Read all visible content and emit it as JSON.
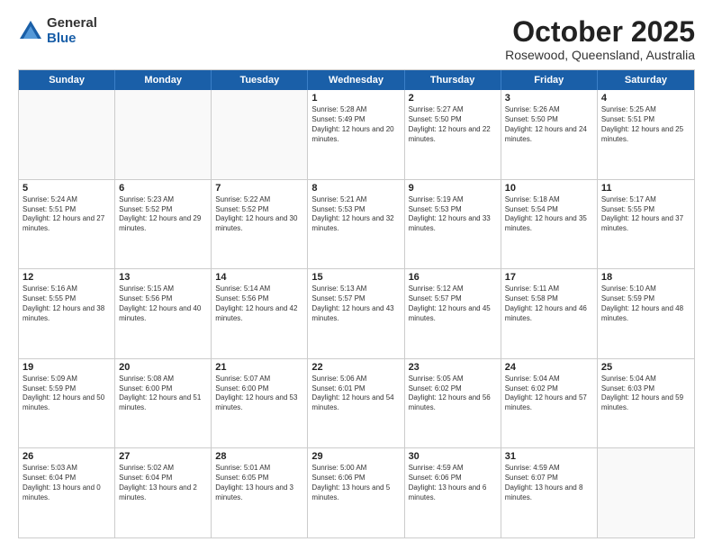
{
  "logo": {
    "general": "General",
    "blue": "Blue"
  },
  "header": {
    "month": "October 2025",
    "location": "Rosewood, Queensland, Australia"
  },
  "weekdays": [
    "Sunday",
    "Monday",
    "Tuesday",
    "Wednesday",
    "Thursday",
    "Friday",
    "Saturday"
  ],
  "rows": [
    [
      {
        "day": "",
        "sunrise": "",
        "sunset": "",
        "daylight": ""
      },
      {
        "day": "",
        "sunrise": "",
        "sunset": "",
        "daylight": ""
      },
      {
        "day": "",
        "sunrise": "",
        "sunset": "",
        "daylight": ""
      },
      {
        "day": "1",
        "sunrise": "Sunrise: 5:28 AM",
        "sunset": "Sunset: 5:49 PM",
        "daylight": "Daylight: 12 hours and 20 minutes."
      },
      {
        "day": "2",
        "sunrise": "Sunrise: 5:27 AM",
        "sunset": "Sunset: 5:50 PM",
        "daylight": "Daylight: 12 hours and 22 minutes."
      },
      {
        "day": "3",
        "sunrise": "Sunrise: 5:26 AM",
        "sunset": "Sunset: 5:50 PM",
        "daylight": "Daylight: 12 hours and 24 minutes."
      },
      {
        "day": "4",
        "sunrise": "Sunrise: 5:25 AM",
        "sunset": "Sunset: 5:51 PM",
        "daylight": "Daylight: 12 hours and 25 minutes."
      }
    ],
    [
      {
        "day": "5",
        "sunrise": "Sunrise: 5:24 AM",
        "sunset": "Sunset: 5:51 PM",
        "daylight": "Daylight: 12 hours and 27 minutes."
      },
      {
        "day": "6",
        "sunrise": "Sunrise: 5:23 AM",
        "sunset": "Sunset: 5:52 PM",
        "daylight": "Daylight: 12 hours and 29 minutes."
      },
      {
        "day": "7",
        "sunrise": "Sunrise: 5:22 AM",
        "sunset": "Sunset: 5:52 PM",
        "daylight": "Daylight: 12 hours and 30 minutes."
      },
      {
        "day": "8",
        "sunrise": "Sunrise: 5:21 AM",
        "sunset": "Sunset: 5:53 PM",
        "daylight": "Daylight: 12 hours and 32 minutes."
      },
      {
        "day": "9",
        "sunrise": "Sunrise: 5:19 AM",
        "sunset": "Sunset: 5:53 PM",
        "daylight": "Daylight: 12 hours and 33 minutes."
      },
      {
        "day": "10",
        "sunrise": "Sunrise: 5:18 AM",
        "sunset": "Sunset: 5:54 PM",
        "daylight": "Daylight: 12 hours and 35 minutes."
      },
      {
        "day": "11",
        "sunrise": "Sunrise: 5:17 AM",
        "sunset": "Sunset: 5:55 PM",
        "daylight": "Daylight: 12 hours and 37 minutes."
      }
    ],
    [
      {
        "day": "12",
        "sunrise": "Sunrise: 5:16 AM",
        "sunset": "Sunset: 5:55 PM",
        "daylight": "Daylight: 12 hours and 38 minutes."
      },
      {
        "day": "13",
        "sunrise": "Sunrise: 5:15 AM",
        "sunset": "Sunset: 5:56 PM",
        "daylight": "Daylight: 12 hours and 40 minutes."
      },
      {
        "day": "14",
        "sunrise": "Sunrise: 5:14 AM",
        "sunset": "Sunset: 5:56 PM",
        "daylight": "Daylight: 12 hours and 42 minutes."
      },
      {
        "day": "15",
        "sunrise": "Sunrise: 5:13 AM",
        "sunset": "Sunset: 5:57 PM",
        "daylight": "Daylight: 12 hours and 43 minutes."
      },
      {
        "day": "16",
        "sunrise": "Sunrise: 5:12 AM",
        "sunset": "Sunset: 5:57 PM",
        "daylight": "Daylight: 12 hours and 45 minutes."
      },
      {
        "day": "17",
        "sunrise": "Sunrise: 5:11 AM",
        "sunset": "Sunset: 5:58 PM",
        "daylight": "Daylight: 12 hours and 46 minutes."
      },
      {
        "day": "18",
        "sunrise": "Sunrise: 5:10 AM",
        "sunset": "Sunset: 5:59 PM",
        "daylight": "Daylight: 12 hours and 48 minutes."
      }
    ],
    [
      {
        "day": "19",
        "sunrise": "Sunrise: 5:09 AM",
        "sunset": "Sunset: 5:59 PM",
        "daylight": "Daylight: 12 hours and 50 minutes."
      },
      {
        "day": "20",
        "sunrise": "Sunrise: 5:08 AM",
        "sunset": "Sunset: 6:00 PM",
        "daylight": "Daylight: 12 hours and 51 minutes."
      },
      {
        "day": "21",
        "sunrise": "Sunrise: 5:07 AM",
        "sunset": "Sunset: 6:00 PM",
        "daylight": "Daylight: 12 hours and 53 minutes."
      },
      {
        "day": "22",
        "sunrise": "Sunrise: 5:06 AM",
        "sunset": "Sunset: 6:01 PM",
        "daylight": "Daylight: 12 hours and 54 minutes."
      },
      {
        "day": "23",
        "sunrise": "Sunrise: 5:05 AM",
        "sunset": "Sunset: 6:02 PM",
        "daylight": "Daylight: 12 hours and 56 minutes."
      },
      {
        "day": "24",
        "sunrise": "Sunrise: 5:04 AM",
        "sunset": "Sunset: 6:02 PM",
        "daylight": "Daylight: 12 hours and 57 minutes."
      },
      {
        "day": "25",
        "sunrise": "Sunrise: 5:04 AM",
        "sunset": "Sunset: 6:03 PM",
        "daylight": "Daylight: 12 hours and 59 minutes."
      }
    ],
    [
      {
        "day": "26",
        "sunrise": "Sunrise: 5:03 AM",
        "sunset": "Sunset: 6:04 PM",
        "daylight": "Daylight: 13 hours and 0 minutes."
      },
      {
        "day": "27",
        "sunrise": "Sunrise: 5:02 AM",
        "sunset": "Sunset: 6:04 PM",
        "daylight": "Daylight: 13 hours and 2 minutes."
      },
      {
        "day": "28",
        "sunrise": "Sunrise: 5:01 AM",
        "sunset": "Sunset: 6:05 PM",
        "daylight": "Daylight: 13 hours and 3 minutes."
      },
      {
        "day": "29",
        "sunrise": "Sunrise: 5:00 AM",
        "sunset": "Sunset: 6:06 PM",
        "daylight": "Daylight: 13 hours and 5 minutes."
      },
      {
        "day": "30",
        "sunrise": "Sunrise: 4:59 AM",
        "sunset": "Sunset: 6:06 PM",
        "daylight": "Daylight: 13 hours and 6 minutes."
      },
      {
        "day": "31",
        "sunrise": "Sunrise: 4:59 AM",
        "sunset": "Sunset: 6:07 PM",
        "daylight": "Daylight: 13 hours and 8 minutes."
      },
      {
        "day": "",
        "sunrise": "",
        "sunset": "",
        "daylight": ""
      }
    ]
  ]
}
